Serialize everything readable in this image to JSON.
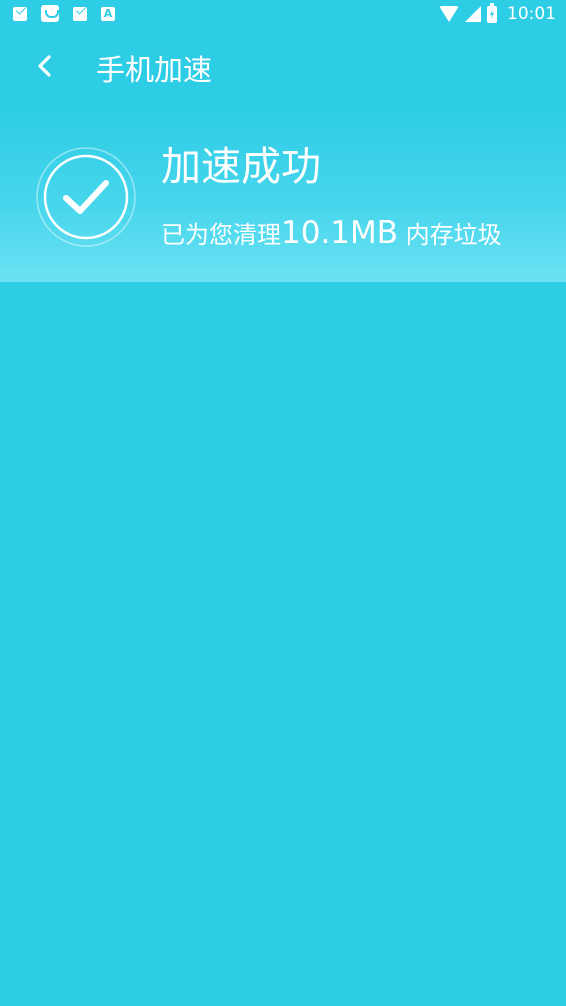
{
  "status_bar": {
    "left_icons": [
      "mail-icon",
      "shopping-bag-icon",
      "mail-icon",
      "app-store-icon"
    ],
    "right_icons": [
      "wifi-icon",
      "signal-icon",
      "battery-charging-icon"
    ],
    "time": "10:01"
  },
  "toolbar": {
    "back_icon": "chevron-left-icon",
    "title": "手机加速"
  },
  "result": {
    "icon": "check-circle-icon",
    "title": "加速成功",
    "desc_prefix": "已为您清理",
    "amount": "10.1MB",
    "desc_suffix": " 内存垃圾"
  },
  "colors": {
    "background": "#2ecde6",
    "header_gradient_end": "#6be1f3",
    "text": "#ffffff"
  }
}
